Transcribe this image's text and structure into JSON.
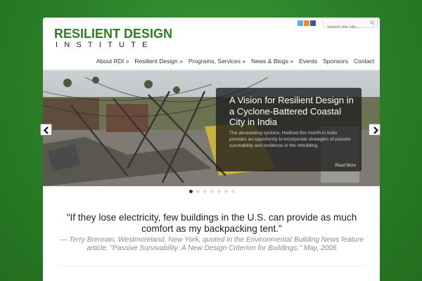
{
  "header": {
    "logo_top": "RESILIENT DESIGN",
    "logo_bottom": "INSTITUTE",
    "search_placeholder": "Search this site...",
    "social": [
      "twitter-icon",
      "rss-icon",
      "facebook-icon"
    ]
  },
  "nav": {
    "items": [
      {
        "label": "About RDI »"
      },
      {
        "label": "Resilient Design »"
      },
      {
        "label": "Programs, Services »"
      },
      {
        "label": "News & Blogs »"
      },
      {
        "label": "Events"
      },
      {
        "label": "Sponsors"
      },
      {
        "label": "Contact"
      }
    ]
  },
  "slider": {
    "title": "A Vision for Resilient Design in a Cyclone-Battered Coastal City in India",
    "text": "The devastating cyclone, Hudhud this month in India provides an opportunity to incorporate strategies of passive survivability and resilience in the rebuilding.",
    "more": "Read More",
    "slide_count": 7,
    "active_index": 0
  },
  "quote": {
    "text": "\"If they lose electricity, few buildings in the U.S. can provide as much comfort as my backpacking tent.\"",
    "attribution": "— Terry Brennan, Westmoreland, New York, quoted in the Environmental Building News feature article, \"Passive Survivability: A New Design Criterion for Buildings,\" May, 2006"
  },
  "colors": {
    "background": "#2e8b2e",
    "brand_green": "#2f7d1f"
  }
}
